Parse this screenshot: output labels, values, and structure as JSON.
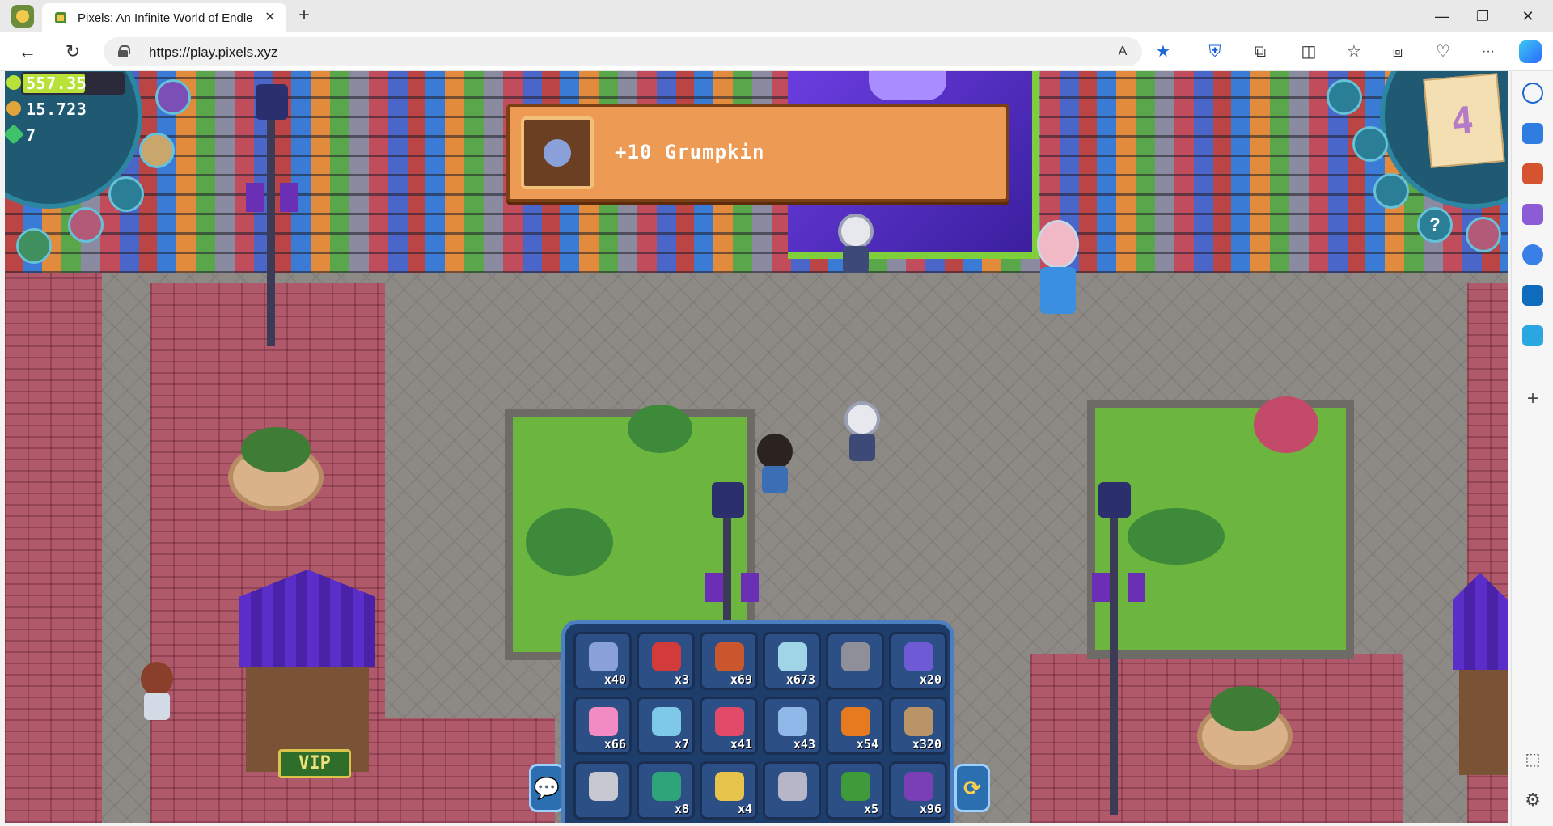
{
  "browser": {
    "tab_title": "Pixels: An Infinite World of Endle",
    "tab_close": "✕",
    "new_tab": "+",
    "url": "https://play.pixels.xyz",
    "window_controls": {
      "minimize": "—",
      "maximize": "❐",
      "close": "✕"
    },
    "nav": {
      "back": "←",
      "reload": "↻"
    },
    "toolbar_icons": [
      "read-aloud-icon",
      "favorite-star-icon",
      "bitwarden-icon",
      "extensions-icon",
      "split-screen-icon",
      "favorites-icon",
      "collections-icon",
      "browser-essentials-icon",
      "more-icon",
      "copilot-icon"
    ],
    "toolbar_glyphs": {
      "read_aloud": "A",
      "favorite": "★",
      "shield": "⛨",
      "extensions": "⧉",
      "split": "◫",
      "favorites": "☆",
      "collections": "⧈",
      "essentials": "♡",
      "more": "···"
    },
    "sidebar_icons": [
      "search-icon",
      "shopping-icon",
      "tools-icon",
      "games-icon",
      "microsoft-365-icon",
      "outlook-icon",
      "send-icon",
      "add-icon",
      "screenshot-icon",
      "settings-icon"
    ],
    "sidebar_glyphs": {
      "add": "+",
      "screenshot": "⬚",
      "settings": "⚙"
    }
  },
  "hud": {
    "energy": "557.35",
    "energy_level": 0.62,
    "coins": "15.723",
    "gems": "7",
    "quest_count": "4",
    "buttons": {
      "help": "?"
    }
  },
  "notification": {
    "text": "+10 Grumpkin"
  },
  "world": {
    "vip_sign": "VIP"
  },
  "inventory": {
    "slots": [
      {
        "name": "grumpkin",
        "count": "x40",
        "color": "#8aa0d8"
      },
      {
        "name": "red-worm",
        "count": "x3",
        "color": "#d33a3a"
      },
      {
        "name": "wheat",
        "count": "x69",
        "color": "#c9562c"
      },
      {
        "name": "water-orb",
        "count": "x673",
        "color": "#9fd5e6"
      },
      {
        "name": "axe",
        "count": "",
        "color": "#8f8f9a"
      },
      {
        "name": "pixel-crate",
        "count": "x20",
        "color": "#6f5ad6"
      },
      {
        "name": "pink-cotton-candy",
        "count": "x66",
        "color": "#f28bc4"
      },
      {
        "name": "blue-cotton-candy",
        "count": "x7",
        "color": "#7ec8e8"
      },
      {
        "name": "heart-potion",
        "count": "x41",
        "color": "#e24a6a"
      },
      {
        "name": "blue-popberry",
        "count": "x43",
        "color": "#8fb8e8"
      },
      {
        "name": "pumpkin",
        "count": "x54",
        "color": "#e67a1f"
      },
      {
        "name": "seed-bag",
        "count": "x320",
        "color": "#b89466"
      },
      {
        "name": "shears",
        "count": "",
        "color": "#c8c8d0"
      },
      {
        "name": "green-card",
        "count": "x8",
        "color": "#2fa37a"
      },
      {
        "name": "cheese-sprout",
        "count": "x4",
        "color": "#e6c34a"
      },
      {
        "name": "watering-can",
        "count": "",
        "color": "#b6b6c8"
      },
      {
        "name": "clover",
        "count": "x5",
        "color": "#3f9a3a"
      },
      {
        "name": "pumpkin-seed-pack",
        "count": "x96",
        "color": "#7b3fb5"
      }
    ],
    "chat_glyph": "💬",
    "swap_glyph": "⟳"
  }
}
